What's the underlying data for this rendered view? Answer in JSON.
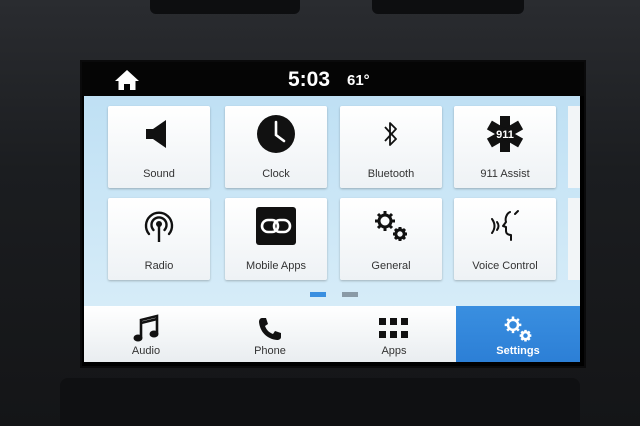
{
  "status": {
    "time": "5:03",
    "temperature": "61°"
  },
  "tiles": [
    {
      "label": "Sound",
      "icon": "speaker-icon"
    },
    {
      "label": "Clock",
      "icon": "clock-icon"
    },
    {
      "label": "Bluetooth",
      "icon": "bluetooth-icon"
    },
    {
      "label": "911 Assist",
      "icon": "star-of-life-icon",
      "badge": "911"
    },
    {
      "label": "Radio",
      "icon": "radio-antenna-icon"
    },
    {
      "label": "Mobile Apps",
      "icon": "link-icon"
    },
    {
      "label": "General",
      "icon": "gears-icon"
    },
    {
      "label": "Voice Control",
      "icon": "voice-icon"
    }
  ],
  "pagination": {
    "pages": 2,
    "current": 1
  },
  "nav": [
    {
      "label": "Audio",
      "icon": "music-note-icon"
    },
    {
      "label": "Phone",
      "icon": "phone-icon"
    },
    {
      "label": "Apps",
      "icon": "grid-icon"
    },
    {
      "label": "Settings",
      "icon": "gears-icon",
      "active": true
    }
  ],
  "colors": {
    "accent": "#2c7fd6",
    "background": "#cde7f6",
    "dot_active": "#3a8fe0",
    "dot_inactive": "#8a9aa6"
  }
}
